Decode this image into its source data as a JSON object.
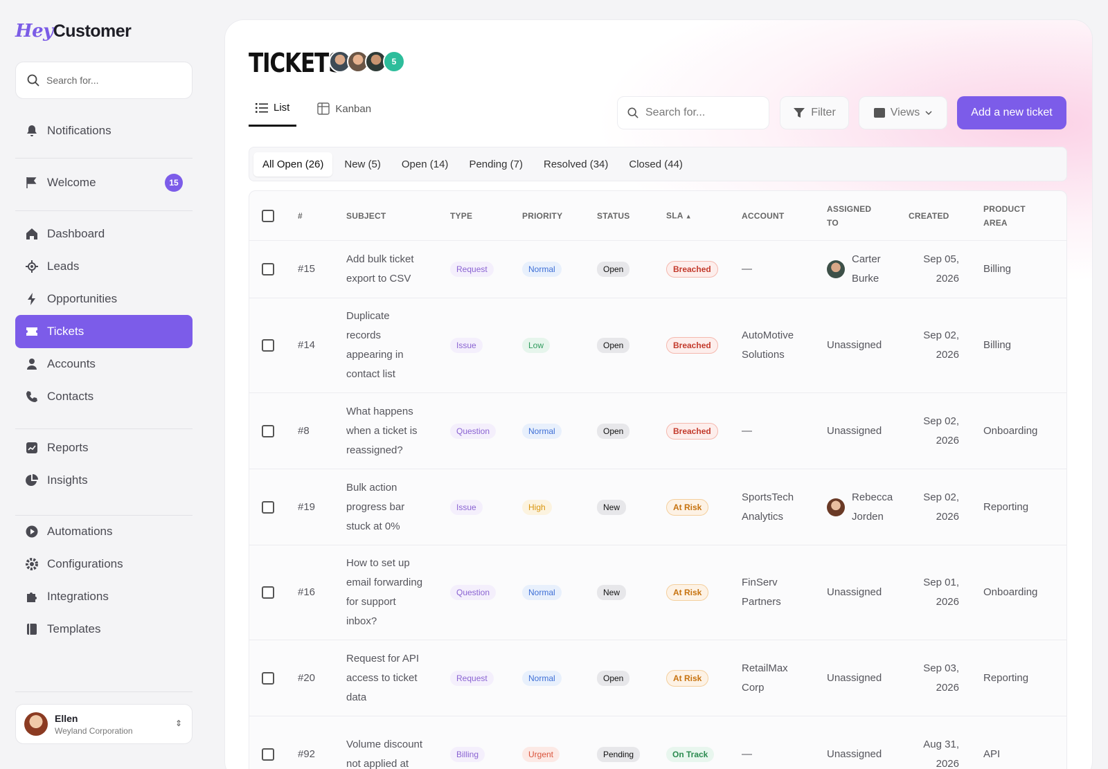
{
  "brand": {
    "hey": "Hey",
    "customer": "Customer"
  },
  "sidebar": {
    "search_placeholder": "Search for...",
    "items": [
      {
        "label": "Notifications",
        "icon": "bell-icon"
      },
      {
        "label": "Welcome",
        "icon": "flag-icon",
        "badge": "15"
      },
      {
        "label": "Dashboard",
        "icon": "home-icon"
      },
      {
        "label": "Leads",
        "icon": "target-icon"
      },
      {
        "label": "Opportunities",
        "icon": "bolt-icon"
      },
      {
        "label": "Tickets",
        "icon": "ticket-icon",
        "active": true
      },
      {
        "label": "Accounts",
        "icon": "person-icon"
      },
      {
        "label": "Contacts",
        "icon": "phone-icon"
      },
      {
        "label": "Reports",
        "icon": "chart-icon"
      },
      {
        "label": "Insights",
        "icon": "pie-icon"
      },
      {
        "label": "Automations",
        "icon": "play-icon"
      },
      {
        "label": "Configurations",
        "icon": "gear-icon"
      },
      {
        "label": "Integrations",
        "icon": "puzzle-icon"
      },
      {
        "label": "Templates",
        "icon": "book-icon"
      }
    ],
    "user": {
      "name": "Ellen",
      "org": "Weyland Corporation"
    }
  },
  "header": {
    "title": "TICKETS",
    "avatar_more": "5",
    "tabs": {
      "list": "List",
      "kanban": "Kanban"
    },
    "search_placeholder": "Search for...",
    "filter": "Filter",
    "views": "Views",
    "add": "Add a new ticket"
  },
  "status_tabs": [
    "All Open (26)",
    "New (5)",
    "Open (14)",
    "Pending (7)",
    "Resolved (34)",
    "Closed (44)"
  ],
  "table": {
    "columns": {
      "id": "#",
      "subject": "SUBJECT",
      "type": "TYPE",
      "priority": "PRIORITY",
      "status": "STATUS",
      "sla": "SLA",
      "account": "ACCOUNT",
      "assigned_1": "ASSIGNED",
      "assigned_2": "TO",
      "created": "CREATED",
      "area_1": "PRODUCT",
      "area_2": "AREA"
    },
    "rows": [
      {
        "id": "#15",
        "subject": [
          "Add bulk ticket",
          "export to CSV"
        ],
        "type": "Request",
        "priority": "Normal",
        "status": "Open",
        "sla": "Breached",
        "account": [
          "—"
        ],
        "assigned": [
          "Carter",
          "Burke"
        ],
        "avatar": "carter",
        "created": [
          "Sep 05,",
          "2026"
        ],
        "area": "Billing"
      },
      {
        "id": "#14",
        "subject": [
          "Duplicate",
          "records",
          "appearing in",
          "contact list"
        ],
        "type": "Issue",
        "priority": "Low",
        "status": "Open",
        "sla": "Breached",
        "account": [
          "AutoMotive",
          "Solutions"
        ],
        "assigned": [
          "Unassigned"
        ],
        "created": [
          "Sep 02,",
          "2026"
        ],
        "area": "Billing"
      },
      {
        "id": "#8",
        "subject": [
          "What happens",
          "when a ticket is",
          "reassigned?"
        ],
        "type": "Question",
        "priority": "Normal",
        "status": "Open",
        "sla": "Breached",
        "account": [
          "—"
        ],
        "assigned": [
          "Unassigned"
        ],
        "created": [
          "Sep 02,",
          "2026"
        ],
        "area": "Onboarding"
      },
      {
        "id": "#19",
        "subject": [
          "Bulk action",
          "progress bar",
          "stuck at 0%"
        ],
        "type": "Issue",
        "priority": "High",
        "status": "New",
        "sla": "At Risk",
        "account": [
          "SportsTech",
          "Analytics"
        ],
        "assigned": [
          "Rebecca",
          "Jorden"
        ],
        "avatar": "rebecca",
        "created": [
          "Sep 02,",
          "2026"
        ],
        "area": "Reporting"
      },
      {
        "id": "#16",
        "subject": [
          "How to set up",
          "email forwarding",
          "for support",
          "inbox?"
        ],
        "type": "Question",
        "priority": "Normal",
        "status": "New",
        "sla": "At Risk",
        "account": [
          "FinServ",
          "Partners"
        ],
        "assigned": [
          "Unassigned"
        ],
        "created": [
          "Sep 01,",
          "2026"
        ],
        "area": "Onboarding"
      },
      {
        "id": "#20",
        "subject": [
          "Request for API",
          "access to ticket",
          "data"
        ],
        "type": "Request",
        "priority": "Normal",
        "status": "Open",
        "sla": "At Risk",
        "account": [
          "RetailMax",
          "Corp"
        ],
        "assigned": [
          "Unassigned"
        ],
        "created": [
          "Sep 03,",
          "2026"
        ],
        "area": "Reporting"
      },
      {
        "id": "#92",
        "subject": [
          "Volume discount",
          "not applied at"
        ],
        "type": "Billing",
        "priority": "Urgent",
        "status": "Pending",
        "sla": "On Track",
        "account": [
          "—"
        ],
        "assigned": [
          "Unassigned"
        ],
        "created": [
          "Aug 31,",
          "2026"
        ],
        "area": "API"
      }
    ]
  }
}
